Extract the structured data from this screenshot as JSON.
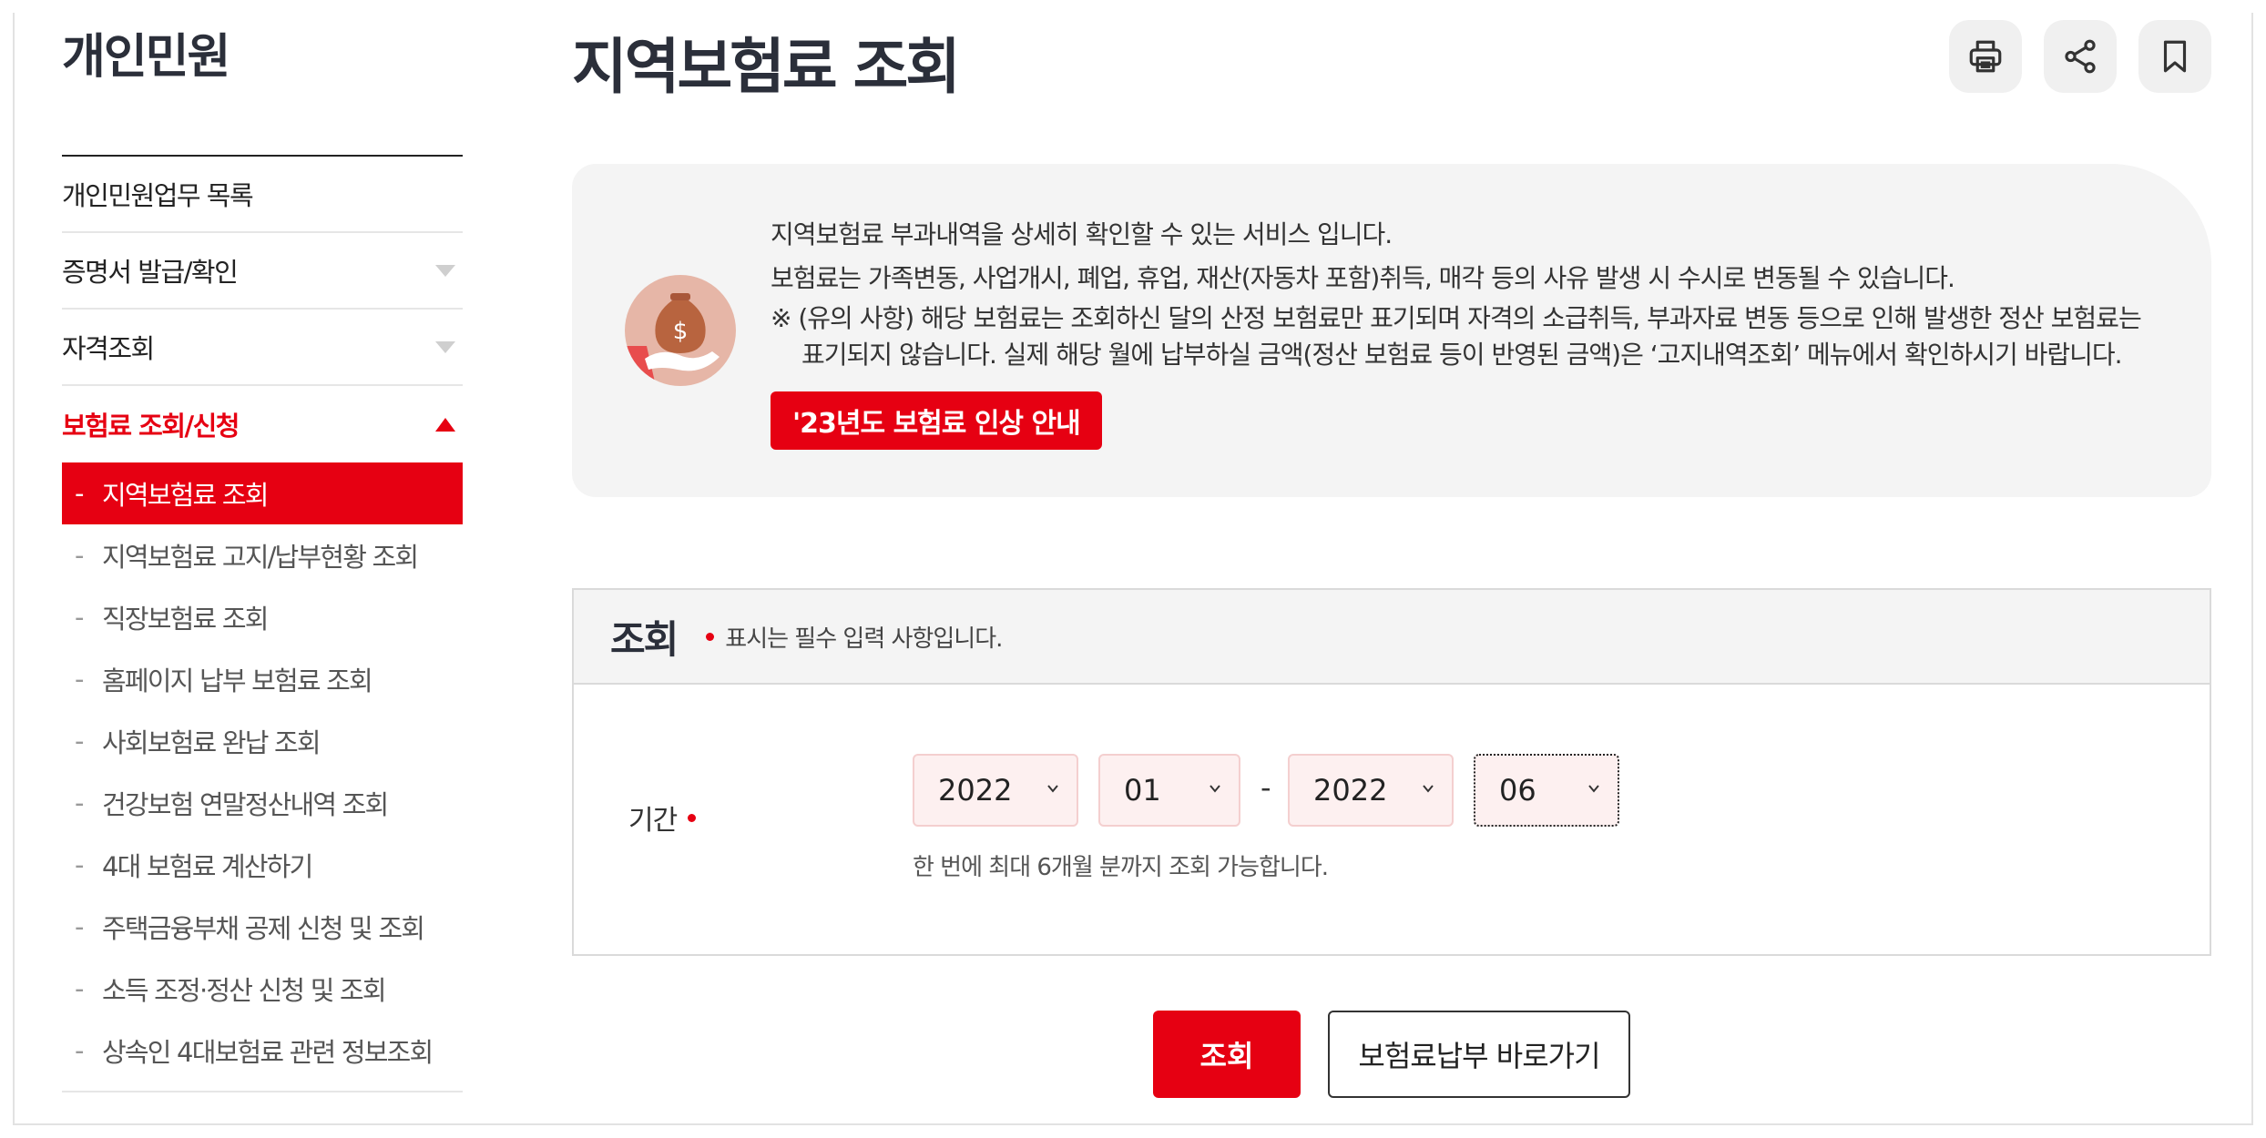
{
  "sidebar": {
    "title": "개인민원",
    "menu": [
      {
        "label": "개인민원업무 목록"
      },
      {
        "label": "증명서 발급/확인"
      },
      {
        "label": "자격조회"
      },
      {
        "label": "보험료 조회/신청"
      }
    ],
    "submenu": [
      {
        "label": "지역보험료 조회"
      },
      {
        "label": "지역보험료 고지/납부현황 조회"
      },
      {
        "label": "직장보험료 조회"
      },
      {
        "label": "홈페이지 납부 보험료 조회"
      },
      {
        "label": "사회보험료 완납 조회"
      },
      {
        "label": "건강보험 연말정산내역 조회"
      },
      {
        "label": "4대 보험료 계산하기"
      },
      {
        "label": "주택금융부채 공제 신청 및 조회"
      },
      {
        "label": "소득 조정·정산 신청 및 조회"
      },
      {
        "label": "상속인 4대보험료 관련 정보조회"
      }
    ],
    "dash": "-"
  },
  "page": {
    "title": "지역보험료 조회",
    "icons": [
      "print-icon",
      "share-icon",
      "bookmark-icon"
    ]
  },
  "info": {
    "line1": "지역보험료 부과내역을 상세히 확인할 수 있는 서비스 입니다.",
    "line2": "보험료는 가족변동, 사업개시, 폐업, 휴업, 재산(자동차 포함)취득, 매각 등의 사유 발생 시 수시로 변동될 수 있습니다.",
    "line3": "※ (유의 사항) 해당 보험료는 조회하신 달의 산정 보험료만 표기되며 자격의 소급취득, 부과자료 변동 등으로 인해 발생한 정산 보험료는",
    "line4": "표기되지 않습니다. 실제 해당 월에 납부하실 금액(정산 보험료 등이 반영된 금액)은 ‘고지내역조회’ 메뉴에서 확인하시기 바랍니다.",
    "notice_button": "'23년도 보험료 인상 안내",
    "coin_symbol": "$"
  },
  "search": {
    "title": "조회",
    "required_note": "표시는 필수 입력 사항입니다.",
    "period_label": "기간",
    "start_year": "2022",
    "start_month": "01",
    "range_separator": "-",
    "end_year": "2022",
    "end_month": "06",
    "help": "한 번에 최대 6개월 분까지 조회 가능합니다."
  },
  "actions": {
    "search_button": "조회",
    "payment_button": "보험료납부 바로가기"
  },
  "colors": {
    "accent": "#e60012",
    "heading": "#2b2f3a",
    "panel_bg": "#f4f4f4",
    "select_bg": "#fdf0f0"
  }
}
